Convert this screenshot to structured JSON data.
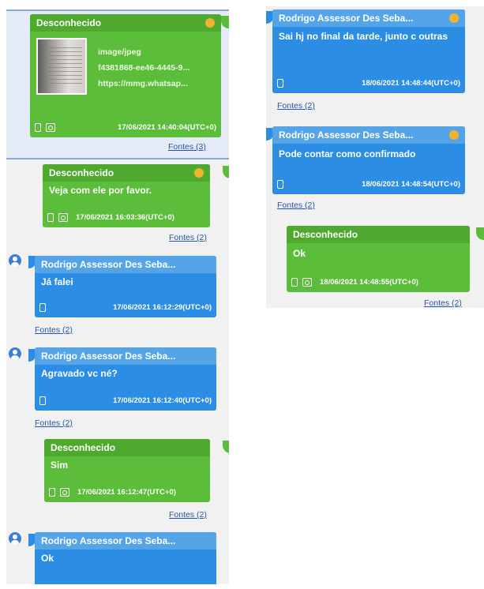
{
  "left": {
    "messages": [
      {
        "sender": "Desconhecido",
        "attachment": {
          "type": "image/jpeg",
          "name": "f4381868-ee46-4445-9...",
          "url": "https://mmg.whatsap..."
        },
        "timestamp": "17/06/2021 14:40:04(UTC+0)",
        "sources": "Fontes (3)"
      },
      {
        "sender": "Desconhecido",
        "text": "Veja com ele por favor.",
        "timestamp": "17/06/2021 16:03:36(UTC+0)",
        "sources": "Fontes (2)"
      },
      {
        "sender": "Rodrigo Assessor Des Seba...",
        "text": "Já falei",
        "timestamp": "17/06/2021 16:12:29(UTC+0)",
        "sources": "Fontes (2)"
      },
      {
        "sender": "Rodrigo Assessor Des Seba...",
        "text": "Agravado vc né?",
        "timestamp": "17/06/2021 16:12:40(UTC+0)",
        "sources": "Fontes (2)"
      },
      {
        "sender": "Desconhecido",
        "text": "Sim",
        "timestamp": "17/06/2021 16:12:47(UTC+0)",
        "sources": "Fontes (2)"
      },
      {
        "sender": "Rodrigo Assessor Des Seba...",
        "text": "Ok"
      }
    ]
  },
  "right": {
    "messages": [
      {
        "sender": "Rodrigo Assessor Des Seba...",
        "text": "Sai hj no final da tarde, junto c outras",
        "timestamp": "18/06/2021 14:48:44(UTC+0)",
        "sources": "Fontes (2)"
      },
      {
        "sender": "Rodrigo Assessor Des Seba...",
        "text": "Pode contar como confirmado",
        "timestamp": "18/06/2021 14:48:54(UTC+0)",
        "sources": "Fontes (2)"
      },
      {
        "sender": "Desconhecido",
        "text": "Ok",
        "timestamp": "18/06/2021 14:48:55(UTC+0)",
        "sources": "Fontes (2)"
      }
    ]
  },
  "colors": {
    "incoming_green": "#5cbd3a",
    "outgoing_blue": "#2b8de3",
    "status_dot": "#f0b331",
    "link": "#2a56a5"
  },
  "icons": [
    "device-icon",
    "image-icon",
    "user-avatar-icon",
    "status-dot-icon"
  ]
}
